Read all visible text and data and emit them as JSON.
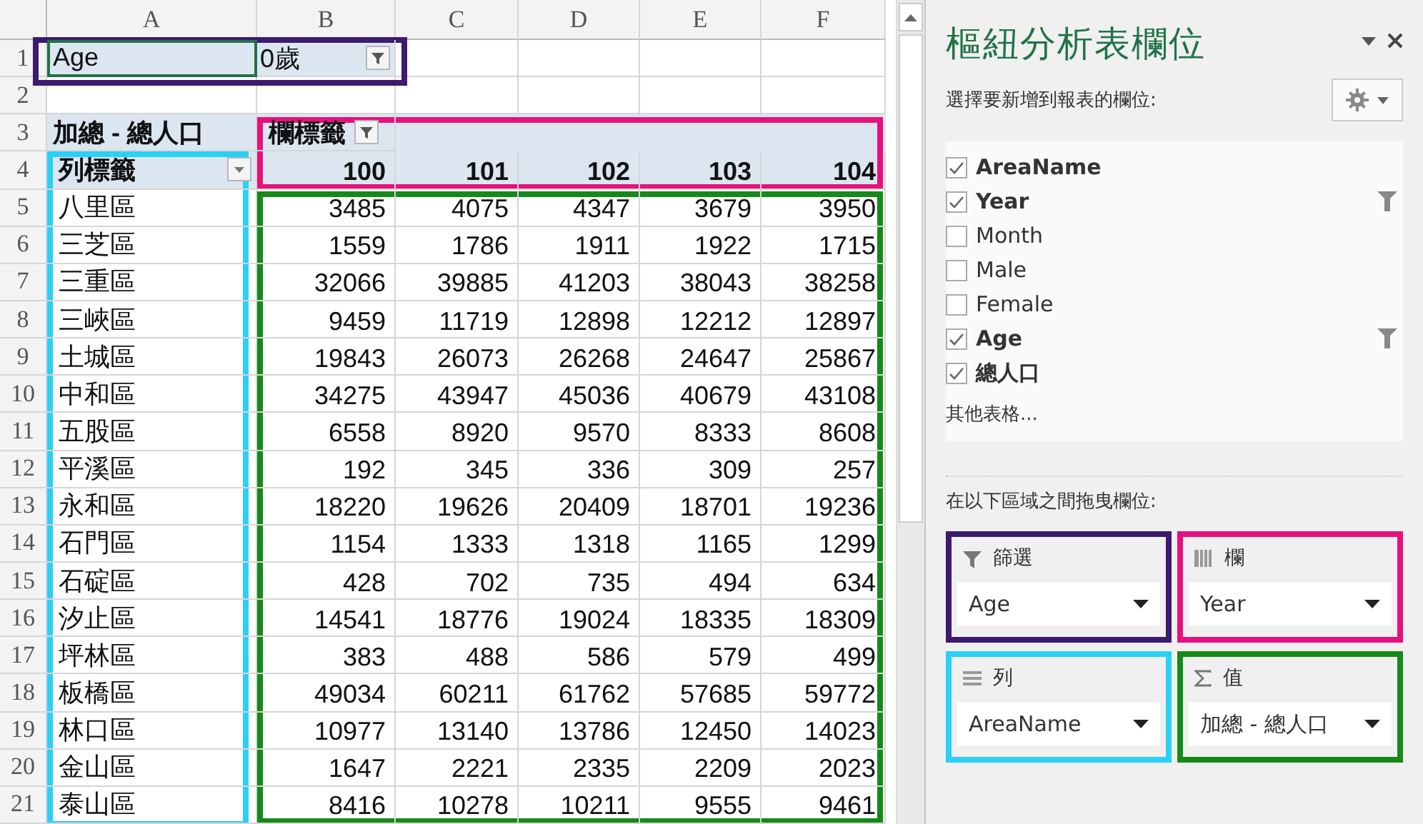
{
  "sheet": {
    "column_headers": [
      "A",
      "B",
      "C",
      "D",
      "E",
      "F"
    ],
    "row_numbers": [
      "1",
      "2",
      "3",
      "4",
      "5",
      "6",
      "7",
      "8",
      "9",
      "10",
      "11",
      "12",
      "13",
      "14",
      "15",
      "16",
      "17",
      "18",
      "19",
      "20",
      "21"
    ],
    "filter": {
      "field": "Age",
      "value": "0歲"
    },
    "value_label": "加總 - 總人口",
    "column_label": "欄標籤",
    "row_label": "列標籤",
    "years": [
      "100",
      "101",
      "102",
      "103",
      "104"
    ],
    "rows": [
      {
        "name": "八里區",
        "values": [
          "3485",
          "4075",
          "4347",
          "3679",
          "3950"
        ]
      },
      {
        "name": "三芝區",
        "values": [
          "1559",
          "1786",
          "1911",
          "1922",
          "1715"
        ]
      },
      {
        "name": "三重區",
        "values": [
          "32066",
          "39885",
          "41203",
          "38043",
          "38258"
        ]
      },
      {
        "name": "三峽區",
        "values": [
          "9459",
          "11719",
          "12898",
          "12212",
          "12897"
        ]
      },
      {
        "name": "土城區",
        "values": [
          "19843",
          "26073",
          "26268",
          "24647",
          "25867"
        ]
      },
      {
        "name": "中和區",
        "values": [
          "34275",
          "43947",
          "45036",
          "40679",
          "43108"
        ]
      },
      {
        "name": "五股區",
        "values": [
          "6558",
          "8920",
          "9570",
          "8333",
          "8608"
        ]
      },
      {
        "name": "平溪區",
        "values": [
          "192",
          "345",
          "336",
          "309",
          "257"
        ]
      },
      {
        "name": "永和區",
        "values": [
          "18220",
          "19626",
          "20409",
          "18701",
          "19236"
        ]
      },
      {
        "name": "石門區",
        "values": [
          "1154",
          "1333",
          "1318",
          "1165",
          "1299"
        ]
      },
      {
        "name": "石碇區",
        "values": [
          "428",
          "702",
          "735",
          "494",
          "634"
        ]
      },
      {
        "name": "汐止區",
        "values": [
          "14541",
          "18776",
          "19024",
          "18335",
          "18309"
        ]
      },
      {
        "name": "坪林區",
        "values": [
          "383",
          "488",
          "586",
          "579",
          "499"
        ]
      },
      {
        "name": "板橋區",
        "values": [
          "49034",
          "60211",
          "61762",
          "57685",
          "59772"
        ]
      },
      {
        "name": "林口區",
        "values": [
          "10977",
          "13140",
          "13786",
          "12450",
          "14023"
        ]
      },
      {
        "name": "金山區",
        "values": [
          "1647",
          "2221",
          "2335",
          "2209",
          "2023"
        ]
      },
      {
        "name": "泰山區",
        "values": [
          "8416",
          "10278",
          "10211",
          "9555",
          "9461"
        ]
      }
    ]
  },
  "panel": {
    "title": "樞紐分析表欄位",
    "subtitle": "選擇要新增到報表的欄位:",
    "fields": [
      {
        "name": "AreaName",
        "checked": true,
        "filtered": false
      },
      {
        "name": "Year",
        "checked": true,
        "filtered": true
      },
      {
        "name": "Month",
        "checked": false,
        "filtered": false
      },
      {
        "name": "Male",
        "checked": false,
        "filtered": false
      },
      {
        "name": "Female",
        "checked": false,
        "filtered": false
      },
      {
        "name": "Age",
        "checked": true,
        "filtered": true
      },
      {
        "name": "總人口",
        "checked": true,
        "filtered": false
      }
    ],
    "more": "其他表格...",
    "drag_hint": "在以下區域之間拖曳欄位:",
    "areas": [
      {
        "kind": "filter",
        "label": "篩選",
        "field": "Age",
        "color": "#3d1a6e"
      },
      {
        "kind": "columns",
        "label": "欄",
        "field": "Year",
        "color": "#e5127d"
      },
      {
        "kind": "rows",
        "label": "列",
        "field": "AreaName",
        "color": "#2ad0f5"
      },
      {
        "kind": "values",
        "label": "值",
        "field": "加總 - 總人口",
        "color": "#17891a"
      }
    ]
  }
}
